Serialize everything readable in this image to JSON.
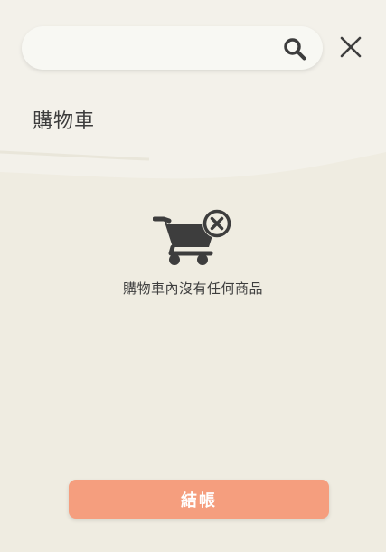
{
  "search": {
    "value": "",
    "placeholder": "",
    "icon": "search-icon"
  },
  "header": {
    "close_icon": "close-icon"
  },
  "page": {
    "title": "購物車"
  },
  "empty_state": {
    "icon": "empty-cart-icon",
    "message": "購物車內沒有任何商品"
  },
  "footer": {
    "checkout_label": "結帳"
  },
  "colors": {
    "background": "#efece1",
    "header_background": "#f3f1ea",
    "search_background": "#f8f8f3",
    "accent": "#f59e7e",
    "text": "#3f3f3f",
    "icon": "#3d3d3d"
  }
}
